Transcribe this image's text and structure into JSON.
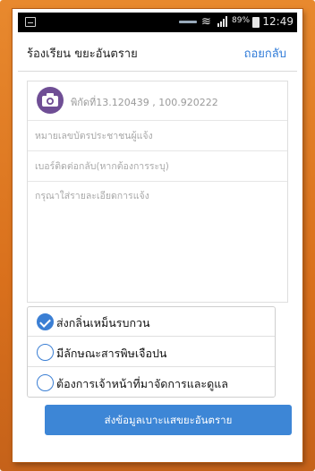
{
  "status_bar": {
    "battery_percent": "89%",
    "time": "12:49"
  },
  "header": {
    "title": "ร้องเรียน ขยะอันตราย",
    "back_label": "ถอยกลับ"
  },
  "form": {
    "coordinates": "พิกัดที่13.120439 , 100.920222",
    "id_card_placeholder": "หมายเลขบัตรประชาชนผู้แจ้ง",
    "phone_placeholder": "เบอร์ติดต่อกลับ(หากต้องการระบุ)",
    "detail_placeholder": "กรุณาใส่รายละเอียดการแจ้ง"
  },
  "options": [
    {
      "label": "ส่งกลิ่นเหม็นรบกวน",
      "checked": true
    },
    {
      "label": "มีลักษณะสารพิษเจือปน",
      "checked": false
    },
    {
      "label": "ต้องการเจ้าหน้าที่มาจัดการและดูแล",
      "checked": false
    }
  ],
  "submit_label": "ส่งข้อมูลเบาะแสขยะอันตราย",
  "colors": {
    "frame": "#d9701c",
    "accent": "#3d86d6",
    "camera": "#6f4e95"
  }
}
